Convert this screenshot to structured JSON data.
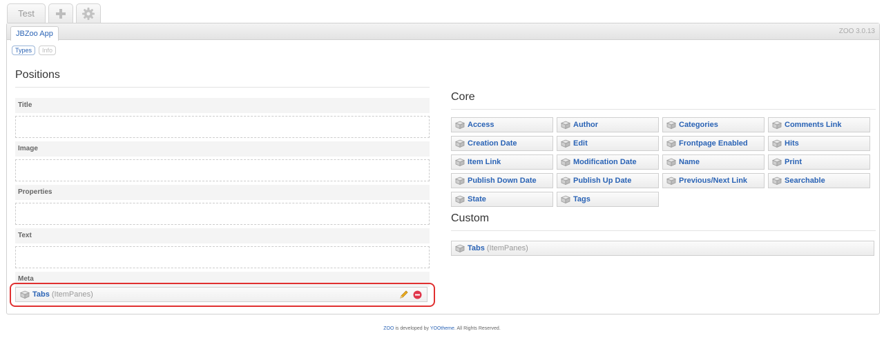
{
  "top_tabs": {
    "test_label": "Test",
    "add_icon": "plus-icon",
    "settings_icon": "gear-icon"
  },
  "app_tab": {
    "label": "JBZoo App"
  },
  "version": "ZOO 3.0.13",
  "sub_tabs": [
    {
      "label": "Types",
      "active": true
    },
    {
      "label": "Info",
      "active": false
    }
  ],
  "positions": {
    "title": "Positions",
    "items": [
      {
        "label": "Title"
      },
      {
        "label": "Image"
      },
      {
        "label": "Properties"
      },
      {
        "label": "Text"
      },
      {
        "label": "Meta"
      }
    ],
    "meta_element": {
      "name": "Tabs",
      "type": "(ItemPanes)",
      "edit_icon": "pencil-icon",
      "delete_icon": "delete-icon"
    }
  },
  "core": {
    "title": "Core",
    "elements": [
      "Access",
      "Author",
      "Categories",
      "Comments Link",
      "Creation Date",
      "Edit",
      "Frontpage Enabled",
      "Hits",
      "Item Link",
      "Modification Date",
      "Name",
      "Print",
      "Publish Down Date",
      "Publish Up Date",
      "Previous/Next Link",
      "Searchable",
      "State",
      "Tags"
    ]
  },
  "custom": {
    "title": "Custom",
    "element": {
      "name": "Tabs",
      "type": "(ItemPanes)"
    }
  },
  "footer": {
    "zoo": "ZOO",
    "middle": " is developed by ",
    "yootheme": "YOOtheme",
    "end": ". All Rights Reserved."
  },
  "colors": {
    "link": "#2a63b5",
    "highlight": "#e03030",
    "delete": "#e0364b"
  }
}
